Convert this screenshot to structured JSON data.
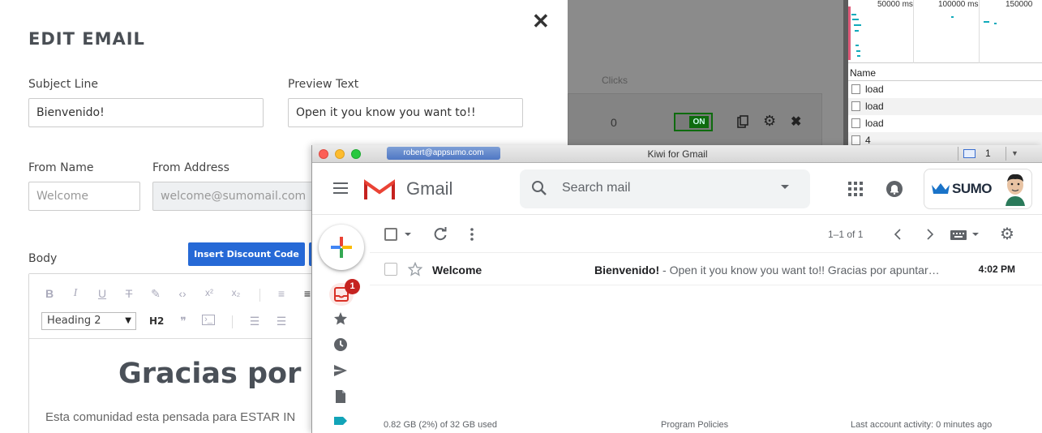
{
  "modal": {
    "title": "EDIT EMAIL",
    "close_glyph": "✕",
    "subject_label": "Subject Line",
    "subject_value": "Bienvenido!",
    "preview_label": "Preview Text",
    "preview_value": "Open it you know you want to!!",
    "from_name_label": "From Name",
    "from_name_placeholder": "Welcome",
    "from_address_label": "From Address",
    "from_address_value": "welcome@sumomail.com",
    "body_label": "Body",
    "insert_discount_label": "Insert Discount Code",
    "heading_select_value": "Heading 2",
    "h2_label": "H2",
    "content_heading": "Gracias por ap",
    "content_text": "Esta comunidad esta pensada para ESTAR IN"
  },
  "background_app": {
    "clicks_header": "Clicks",
    "clicks_value": "0",
    "toggle_label": "ON"
  },
  "network": {
    "ticks": [
      "50000 ms",
      "100000 ms",
      "150000"
    ],
    "name_header": "Name",
    "rows": [
      "load",
      "load",
      "load",
      "4"
    ]
  },
  "kiwi": {
    "account_pill": "robert@appsumo.com",
    "window_title": "Kiwi for Gmail",
    "mail_count": "1",
    "toolbar_caret": "▼"
  },
  "gmail": {
    "logo_word": "Gmail",
    "search_placeholder": "Search mail",
    "account_brand": "SUMO",
    "pager": "1–1 of 1",
    "inbox_badge": "1",
    "emails": [
      {
        "sender": "Welcome",
        "subject": "Bienvenido!",
        "snippet": " - Open it you know you want to!! Gracias por apuntar…",
        "time": "4:02 PM"
      }
    ],
    "footer_storage": "0.82 GB (2%) of 32 GB used",
    "footer_policies": "Program Policies",
    "footer_activity": "Last account activity: 0 minutes ago"
  },
  "colors": {
    "accent_blue": "#2669d6",
    "gmail_red": "#c5221f",
    "toggle_green": "#0e6b0e"
  }
}
